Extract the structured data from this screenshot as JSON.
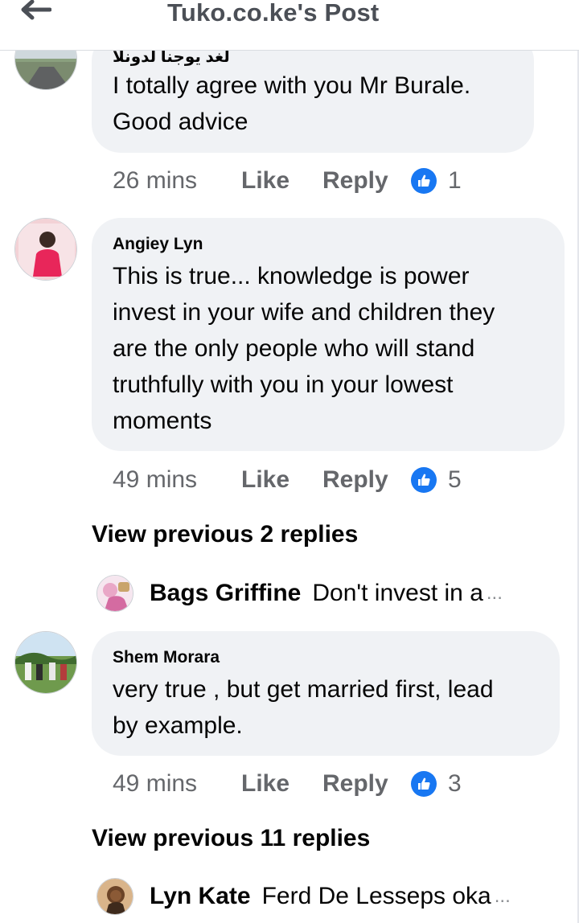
{
  "header": {
    "title": "Tuko.co.ke's Post",
    "back_icon": "arrow-left-icon"
  },
  "comments": [
    {
      "author": "لغد يوجنا لدونلا",
      "text_lines": [
        "I totally agree with you Mr Burale.",
        "Good advice"
      ],
      "time": "26 mins",
      "like_label": "Like",
      "reply_label": "Reply",
      "reaction_icon": "thumbs-up-icon",
      "reaction_count": "1"
    },
    {
      "author": "Angiey Lyn",
      "text_lines": [
        "This is true... knowledge is power",
        "invest in your wife and children they",
        "are the only people who will stand",
        "truthfully with you in your lowest",
        "moments"
      ],
      "time": "49 mins",
      "like_label": "Like",
      "reply_label": "Reply",
      "reaction_icon": "thumbs-up-icon",
      "reaction_count": "5",
      "view_previous": "View previous 2 replies",
      "reply_preview": {
        "author": "Bags Griffine",
        "text": "Don't invest in a",
        "ellipsis": "..."
      }
    },
    {
      "author": "Shem Morara",
      "text_lines": [
        "very true , but get married first, lead",
        "by example."
      ],
      "time": "49 mins",
      "like_label": "Like",
      "reply_label": "Reply",
      "reaction_icon": "thumbs-up-icon",
      "reaction_count": "3",
      "view_previous": "View previous 11 replies",
      "reply_preview": {
        "author": "Lyn Kate",
        "text": "Ferd De Lesseps oka",
        "ellipsis": "..."
      }
    }
  ],
  "colors": {
    "bubble": "#f0f2f5",
    "meta_text": "#65676b",
    "like_blue": "#1877f2"
  }
}
